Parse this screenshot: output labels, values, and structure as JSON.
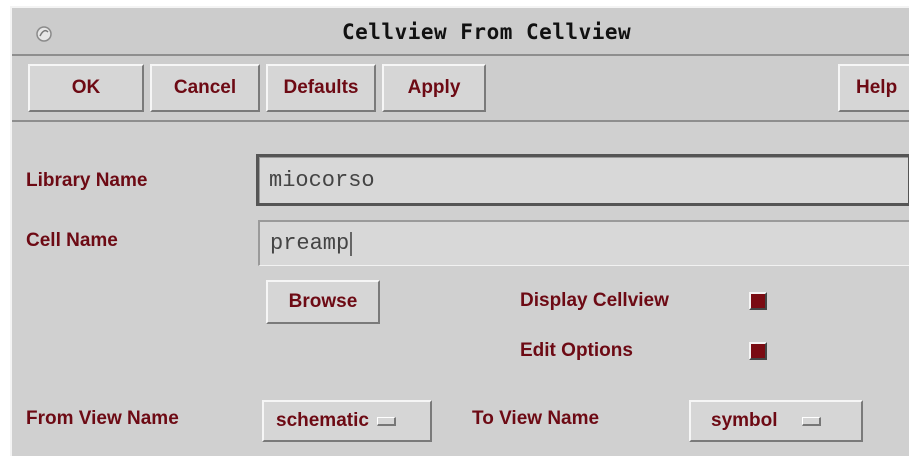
{
  "window": {
    "title": "Cellview From Cellview"
  },
  "buttons": {
    "ok": "OK",
    "cancel": "Cancel",
    "defaults": "Defaults",
    "apply": "Apply",
    "help": "Help"
  },
  "form": {
    "library_label": "Library Name",
    "library_value": "miocorso",
    "cell_label": "Cell Name",
    "cell_value": "preamp",
    "browse_label": "Browse",
    "display_cellview_label": "Display Cellview",
    "display_cellview_checked": true,
    "edit_options_label": "Edit Options",
    "edit_options_checked": true,
    "from_view_label": "From View Name",
    "from_view_value": "schematic",
    "to_view_label": "To View Name",
    "to_view_value": "symbol"
  },
  "colors": {
    "label_text": "#6d0a14",
    "checkbox_on": "#7a0b12",
    "background": "#d0d0d0"
  },
  "icons": {
    "window_menu": "window-menu-icon"
  }
}
